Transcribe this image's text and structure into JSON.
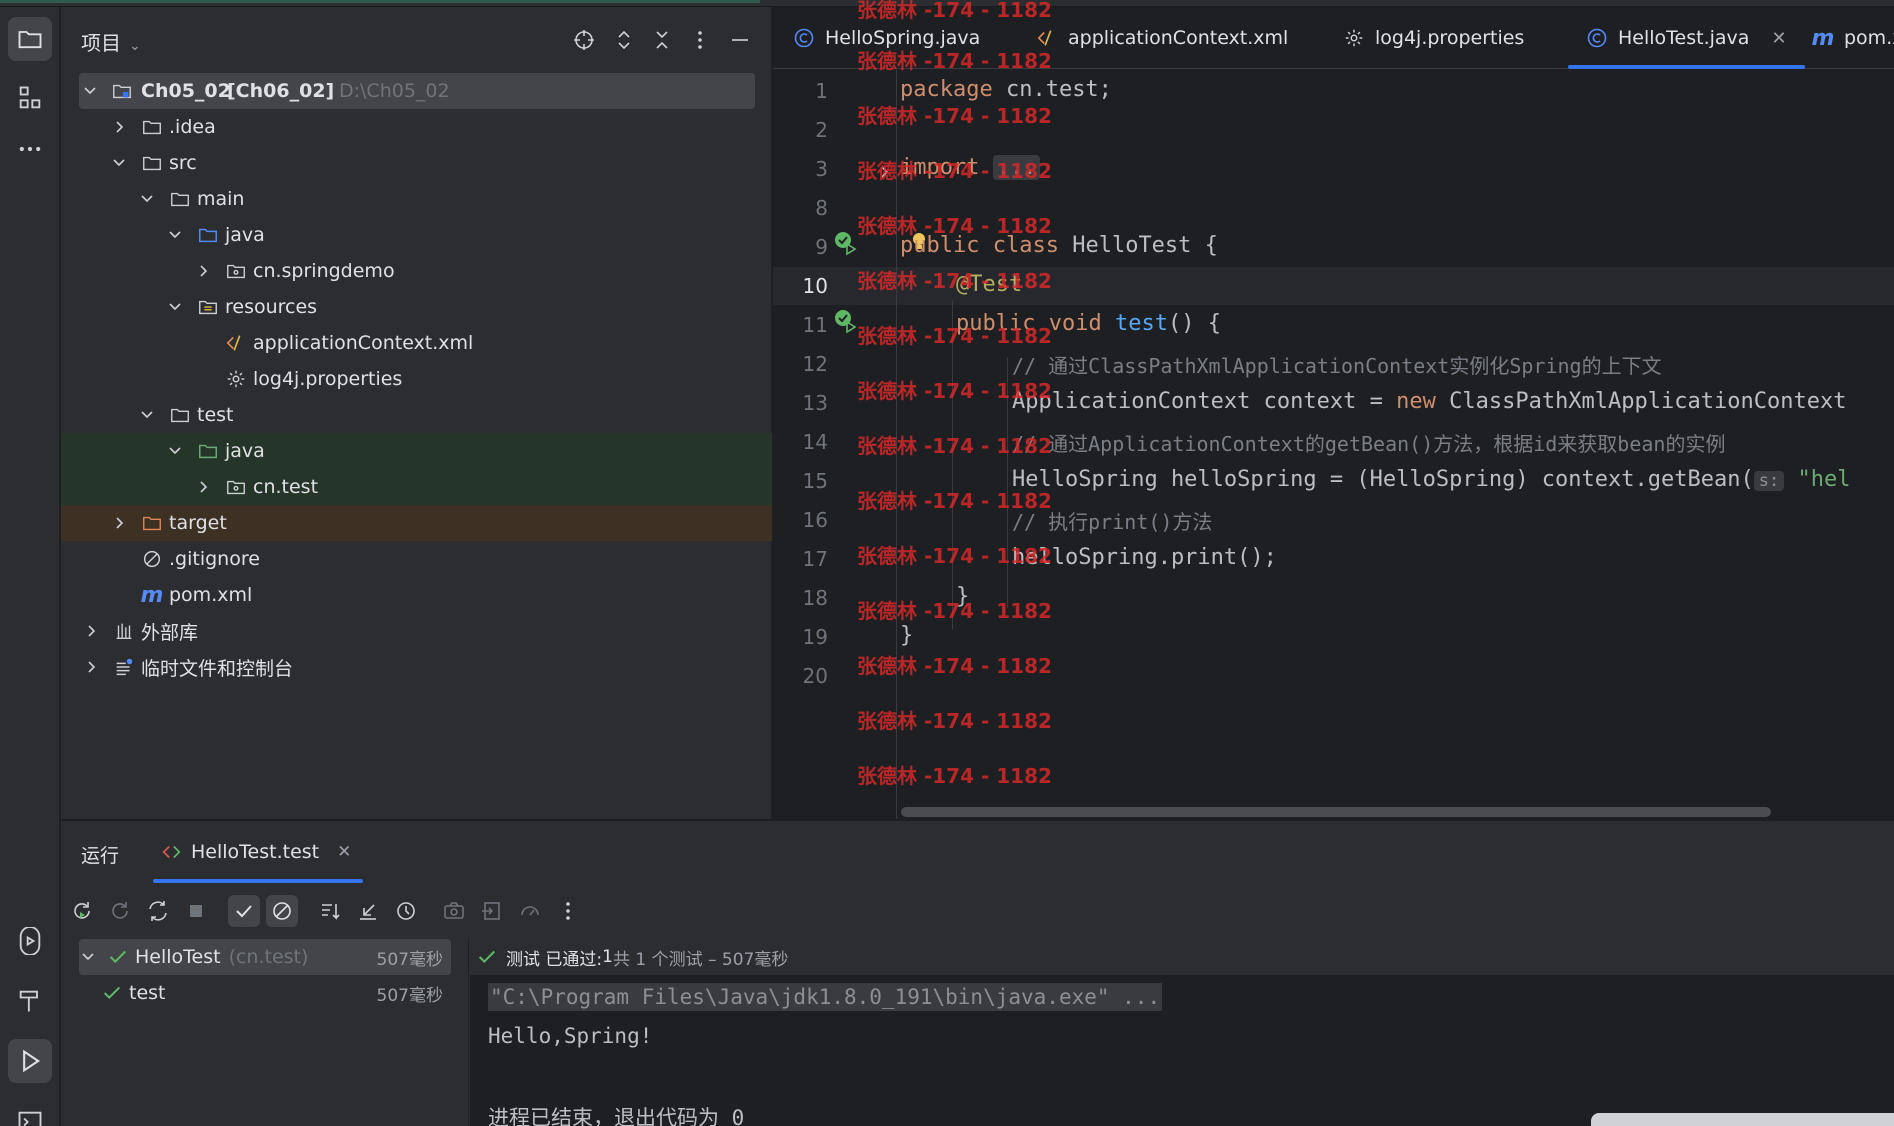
{
  "project_panel": {
    "title": "项目",
    "tree": [
      {
        "label": "Ch05_02",
        "module": "[Ch06_02]",
        "path": "D:\\Ch05_02"
      },
      {
        "label": ".idea"
      },
      {
        "label": "src"
      },
      {
        "label": "main"
      },
      {
        "label": "java"
      },
      {
        "label": "cn.springdemo"
      },
      {
        "label": "resources"
      },
      {
        "label": "applicationContext.xml"
      },
      {
        "label": "log4j.properties"
      },
      {
        "label": "test"
      },
      {
        "label": "java"
      },
      {
        "label": "cn.test"
      },
      {
        "label": "target"
      },
      {
        "label": ".gitignore"
      },
      {
        "label": "pom.xml"
      },
      {
        "label": "外部库"
      },
      {
        "label": "临时文件和控制台"
      }
    ]
  },
  "editor_tabs": [
    {
      "label": "HelloSpring.java",
      "icon": "class-icon"
    },
    {
      "label": "applicationContext.xml",
      "icon": "xml-icon"
    },
    {
      "label": "log4j.properties",
      "icon": "gear-icon"
    },
    {
      "label": "HelloTest.java",
      "icon": "class-icon",
      "active": true
    },
    {
      "label": "pom.x",
      "icon": "maven-icon"
    }
  ],
  "editor": {
    "line_numbers": [
      "1",
      "2",
      "3",
      "8",
      "9",
      "10",
      "11",
      "12",
      "13",
      "14",
      "15",
      "16",
      "17",
      "18",
      "19",
      "20"
    ],
    "code": {
      "l1_kw": "package",
      "l1_rest": " cn.test;",
      "l3_kw": "import",
      "l3_fold": "...",
      "l9_kw1": "public",
      "l9_kw2": "class",
      "l9_rest": " HelloTest {",
      "l10_ann": "@Test",
      "l11_kw1": "public",
      "l11_kw2": "void",
      "l11_fn": "test",
      "l11_rest": "() {",
      "l12_cmt": "// 通过ClassPathXmlApplicationContext实例化Spring的上下文",
      "l13_a": "ApplicationContext context = ",
      "l13_kw": "new",
      "l13_b": " ClassPathXmlApplicationContext",
      "l14_cmt": "// 通过ApplicationContext的getBean()方法，根据id来获取bean的实例",
      "l15_a": "HelloSpring helloSpring = (HelloSpring) context.getBean(",
      "l15_hint": "s:",
      "l15_str": "\"hel",
      "l16_cmt": "// 执行print()方法",
      "l17": "helloSpring.print();",
      "l18": "}",
      "l19": "}"
    }
  },
  "watermark": "张德林 -174 - 1182",
  "run_panel": {
    "label": "运行",
    "tab": "HelloTest.test",
    "tests": [
      {
        "name": "HelloTest",
        "pkg": "(cn.test)",
        "time": "507毫秒"
      },
      {
        "name": "test",
        "time": "507毫秒"
      }
    ],
    "status_prefix": "测试 已通过: ",
    "status_count": "1",
    "status_suffix": "共 1 个测试 – 507毫秒",
    "console_lines": [
      "\"C:\\Program Files\\Java\\jdk1.8.0_191\\bin\\java.exe\" ...",
      "Hello,Spring!",
      "",
      "进程已结束，退出代码为 0"
    ]
  },
  "colors": {
    "accent": "#3574f0",
    "pass_green": "#5fb865",
    "keyword": "#cf8e6d",
    "function": "#56a8f5",
    "annotation": "#b3ae60",
    "string": "#6aab73",
    "watermark": "#dc2828"
  }
}
